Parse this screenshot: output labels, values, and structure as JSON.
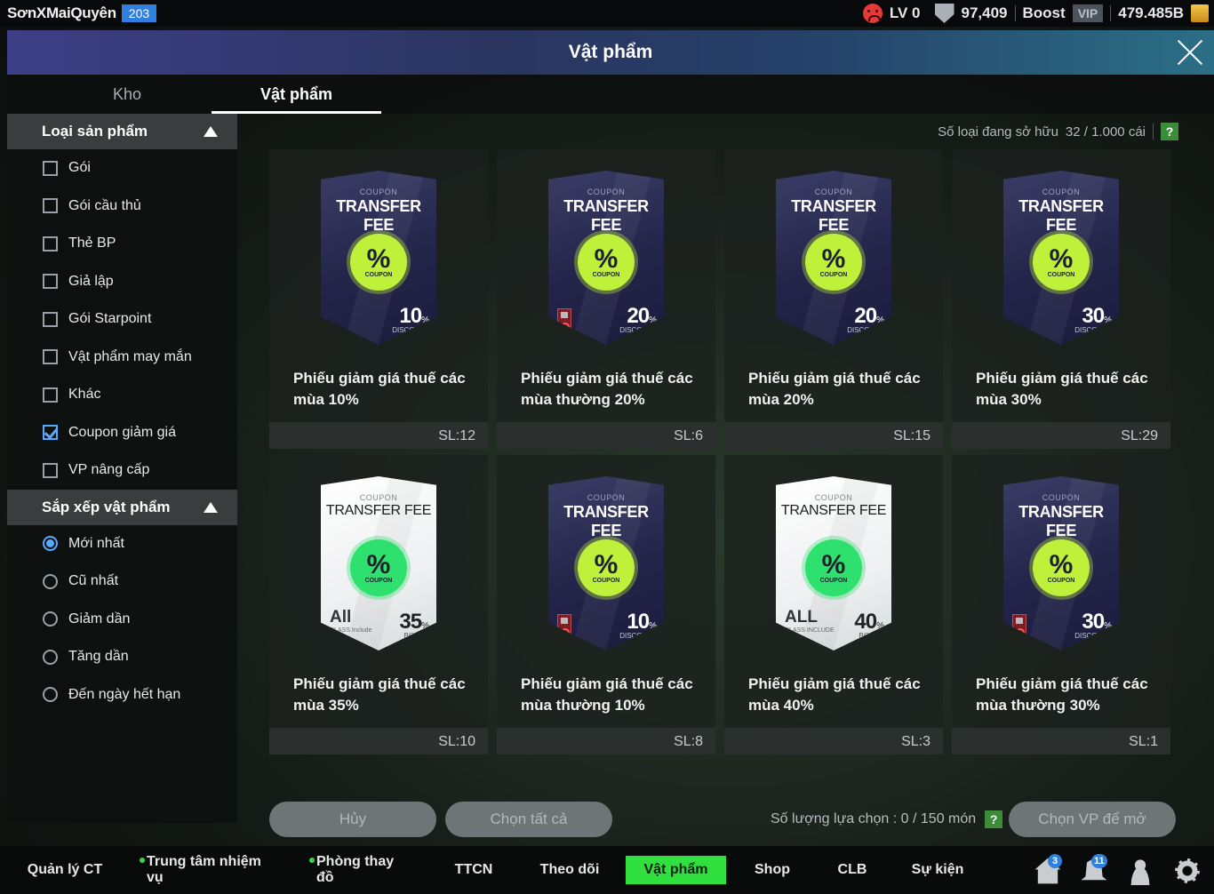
{
  "user": {
    "name": "SơnXMaiQuyên",
    "level": "203"
  },
  "status": {
    "lv": "LV 0",
    "points": "97,409",
    "boost_label": "Boost",
    "vip_label": "VIP",
    "currency": "479.485B"
  },
  "modal": {
    "title": "Vật phẩm"
  },
  "tabs": [
    {
      "label": "Kho",
      "active": false
    },
    {
      "label": "Vật phẩm",
      "active": true
    }
  ],
  "filter": {
    "header": "Loại sản phẩm",
    "items": [
      {
        "label": "Gói",
        "checked": false
      },
      {
        "label": "Gói cầu thủ",
        "checked": false
      },
      {
        "label": "Thẻ BP",
        "checked": false
      },
      {
        "label": "Giả lập",
        "checked": false
      },
      {
        "label": "Gói Starpoint",
        "checked": false
      },
      {
        "label": "Vật phẩm may mắn",
        "checked": false
      },
      {
        "label": "Khác",
        "checked": false
      },
      {
        "label": "Coupon giảm giá",
        "checked": true
      },
      {
        "label": "VP nâng cấp",
        "checked": false
      }
    ]
  },
  "sort": {
    "header": "Sắp xếp vật phẩm",
    "items": [
      {
        "label": "Mới nhất",
        "checked": true
      },
      {
        "label": "Cũ nhất",
        "checked": false
      },
      {
        "label": "Giảm dần",
        "checked": false
      },
      {
        "label": "Tăng dần",
        "checked": false
      },
      {
        "label": "Đến ngày hết hạn",
        "checked": false
      }
    ]
  },
  "owned": {
    "label": "Số loại đang sở hữu",
    "value": "32 / 1.000 cái",
    "help": "?"
  },
  "coupon_text": {
    "top": "COUPON",
    "title": "TRANSFER FEE",
    "badge": "%",
    "badge_small": "COUPON",
    "percent_sign": "%"
  },
  "items": [
    {
      "name": "Phiếu giảm giá thuế các mùa 10%",
      "qty": "SL:12",
      "value": "10",
      "sub": "DISCOUNT",
      "style": "dark",
      "untradeable": false
    },
    {
      "name": "Phiếu giảm giá thuế các mùa thường 20%",
      "qty": "SL:6",
      "value": "20",
      "sub": "DISCOUNT",
      "style": "dark",
      "untradeable": true
    },
    {
      "name": "Phiếu giảm giá thuế các mùa 20%",
      "qty": "SL:15",
      "value": "20",
      "sub": "DISCOUNT",
      "style": "dark",
      "untradeable": false
    },
    {
      "name": "Phiếu giảm giá thuế các mùa 30%",
      "qty": "SL:29",
      "value": "30",
      "sub": "DISCOUNT",
      "style": "dark",
      "untradeable": false
    },
    {
      "name": "Phiếu giảm giá thuế các mùa 35%",
      "qty": "SL:10",
      "value": "35",
      "sub": "BONUS",
      "style": "light",
      "untradeable": false,
      "class_all": "All",
      "class_sub": "CLASS Include"
    },
    {
      "name": "Phiếu giảm giá thuế các mùa thường 10%",
      "qty": "SL:8",
      "value": "10",
      "sub": "DISCOUNT",
      "style": "dark",
      "untradeable": true
    },
    {
      "name": "Phiếu giảm giá thuế các mùa 40%",
      "qty": "SL:3",
      "value": "40",
      "sub": "BONUS",
      "style": "light",
      "untradeable": false,
      "class_all": "ALL",
      "class_sub": "CLASS INCLUDE"
    },
    {
      "name": "Phiếu giảm giá thuế các mùa thường 30%",
      "qty": "SL:1",
      "value": "30",
      "sub": "DISCOUNT",
      "style": "dark",
      "untradeable": true
    }
  ],
  "actions": {
    "cancel": "Hủy",
    "select_all": "Chọn tất cả",
    "select_count": "Số lượng lựa chọn : 0 / 150 món",
    "help": "?",
    "open_vp": "Chọn VP để mở"
  },
  "nav": [
    {
      "label": "Quản lý CT",
      "dot": false,
      "active": false
    },
    {
      "label": "Trung tâm nhiệm vụ",
      "dot": true,
      "active": false
    },
    {
      "label": "Phòng thay đồ",
      "dot": true,
      "active": false
    },
    {
      "label": "TTCN",
      "dot": false,
      "active": false
    },
    {
      "label": "Theo dõi",
      "dot": false,
      "active": false
    },
    {
      "label": "Vật phẩm",
      "dot": false,
      "active": true
    },
    {
      "label": "Shop",
      "dot": false,
      "active": false
    },
    {
      "label": "CLB",
      "dot": false,
      "active": false
    },
    {
      "label": "Sự kiện",
      "dot": false,
      "active": false
    }
  ],
  "nav_icons": [
    {
      "name": "home-icon",
      "badge": "3"
    },
    {
      "name": "bell-icon",
      "badge": "11"
    },
    {
      "name": "profile-icon",
      "badge": ""
    },
    {
      "name": "gear-icon",
      "badge": ""
    }
  ],
  "colors": {
    "accent_green": "#2fe03e",
    "check_blue": "#5aa8ff",
    "level_blue": "#2f7fe0"
  }
}
